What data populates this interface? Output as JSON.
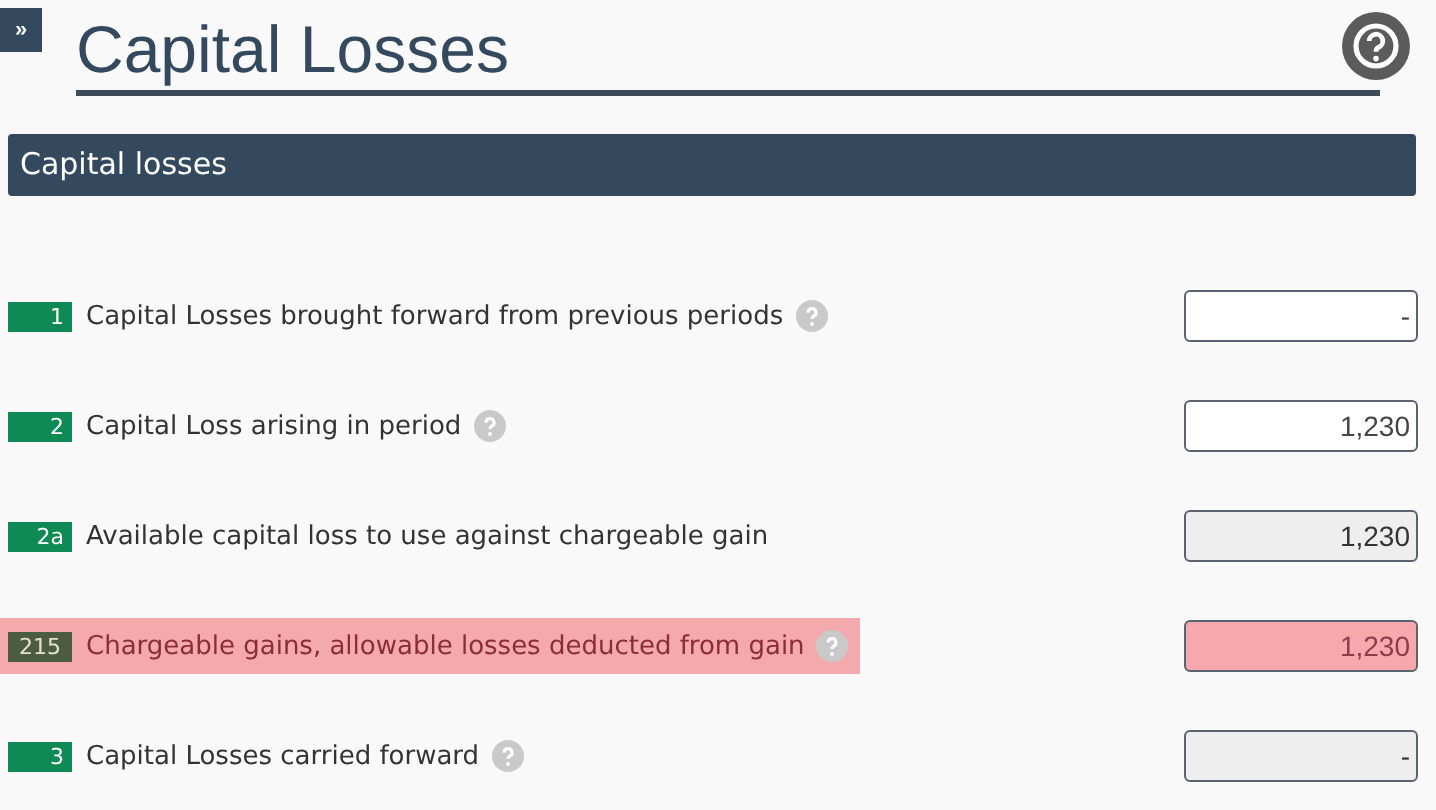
{
  "expand_button": {
    "label": "»"
  },
  "page": {
    "title": "Capital Losses"
  },
  "section": {
    "title": "Capital losses"
  },
  "rows": [
    {
      "code": "1",
      "label": "Capital Losses brought forward from previous periods",
      "help": true,
      "value": "-",
      "kind": "input"
    },
    {
      "code": "2",
      "label": "Capital Loss arising in period",
      "help": true,
      "value": "1,230",
      "kind": "input"
    },
    {
      "code": "2a",
      "label": "Available capital loss to use against chargeable gain",
      "help": false,
      "value": "1,230",
      "kind": "calculated"
    },
    {
      "code": "215",
      "label": "Chargeable gains, allowable losses deducted from gain",
      "help": true,
      "value": "1,230",
      "kind": "error"
    },
    {
      "code": "3",
      "label": "Capital Losses carried forward",
      "help": true,
      "value": "-",
      "kind": "calculated"
    }
  ]
}
